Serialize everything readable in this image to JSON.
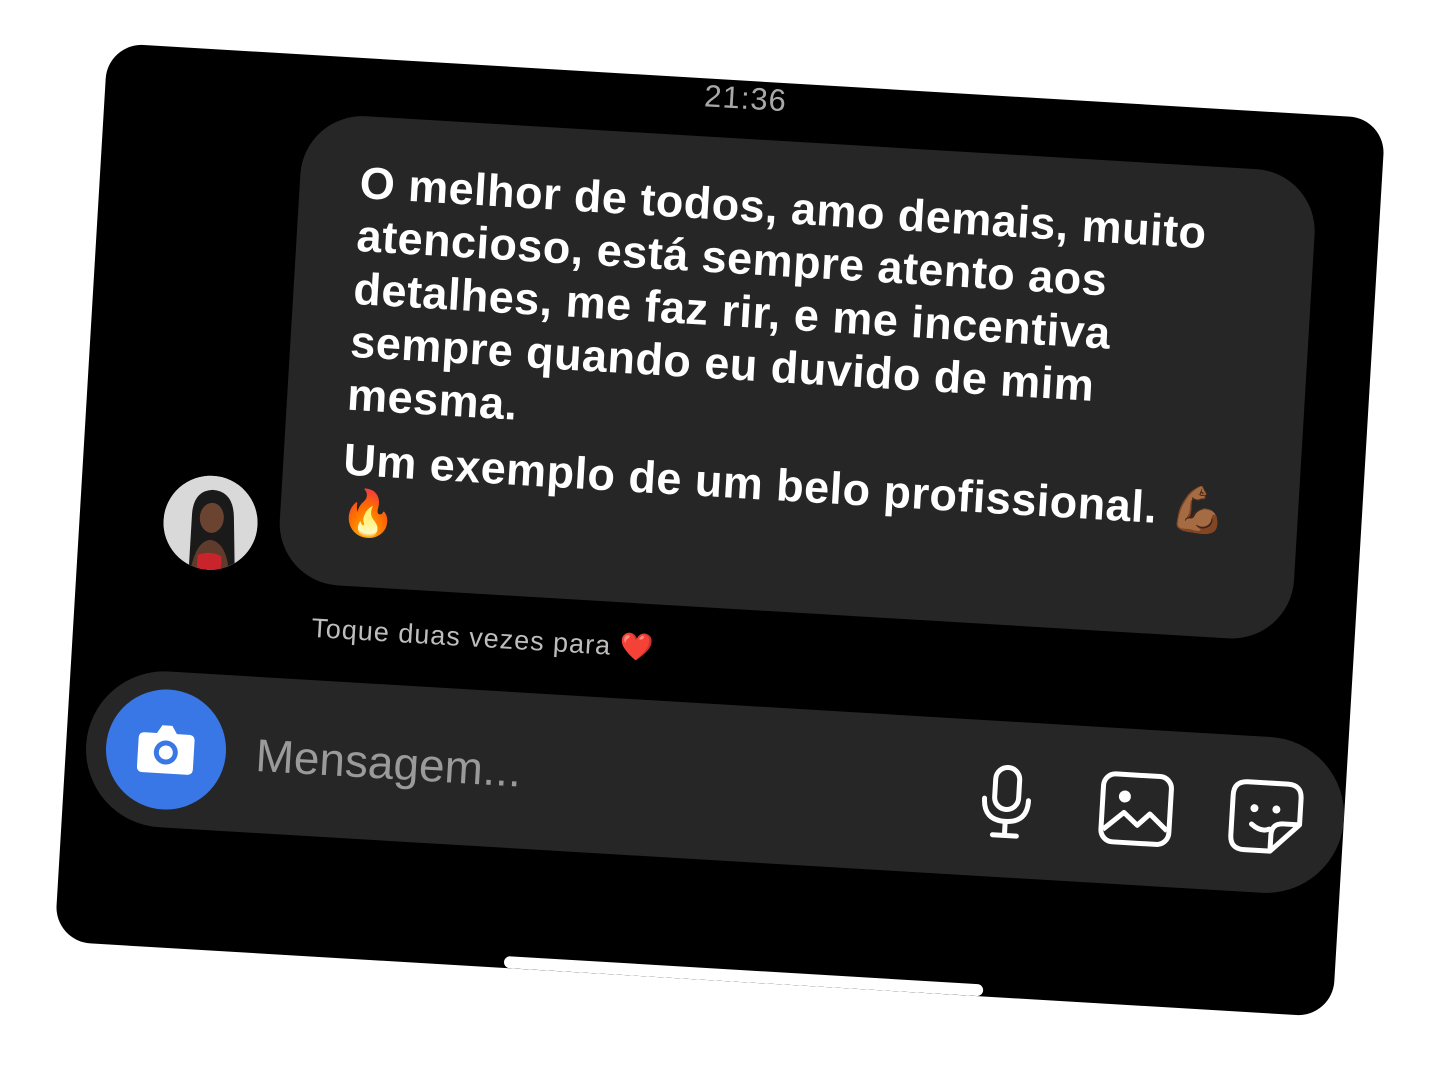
{
  "status": {
    "time": "21:36"
  },
  "message": {
    "text": "O melhor de todos, amo demais, muito atencioso, está sempre atento aos detalhes, me faz rir, e me incentiva sempre quando eu duvido de mim mesma.",
    "text2": "Um exemplo de um belo profissional. 💪🏾🔥"
  },
  "hint": {
    "text": "Toque duas vezes para ❤️"
  },
  "composer": {
    "placeholder": "Mensagem..."
  },
  "colors": {
    "background": "#000000",
    "bubble": "#262626",
    "camera_button": "#3a77e6",
    "text": "#ffffff",
    "muted_text": "#a8a8a8"
  },
  "icons": {
    "avatar": "profile-photo",
    "camera": "camera-icon",
    "microphone": "microphone-icon",
    "gallery": "gallery-icon",
    "sticker": "sticker-icon"
  }
}
